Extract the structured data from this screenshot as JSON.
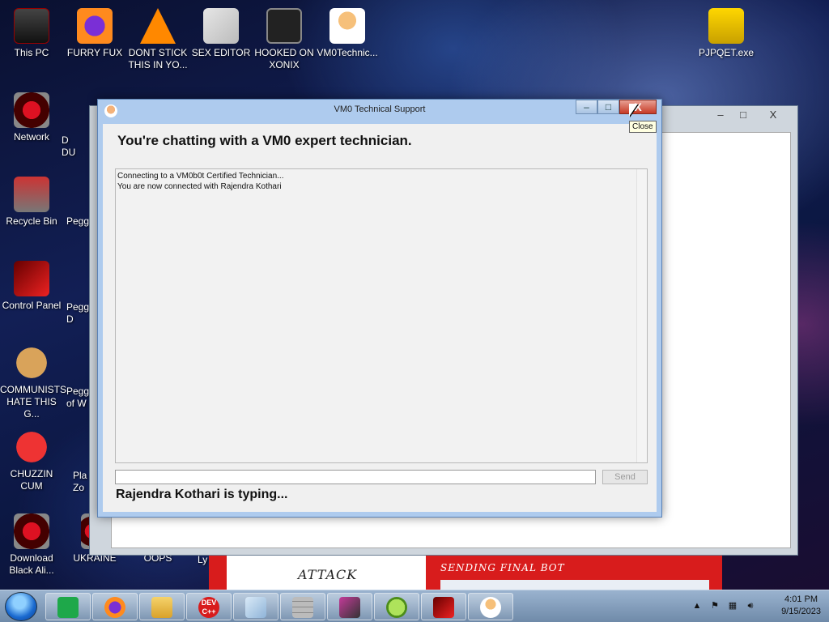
{
  "desktop": {
    "icons": [
      {
        "label": "This PC",
        "icon": "computer-icon"
      },
      {
        "label": "FURRY FUX",
        "icon": "firefox-icon"
      },
      {
        "label": "DONT STICK THIS IN YO...",
        "icon": "vlc-icon"
      },
      {
        "label": "SEX EDITOR",
        "icon": "hxd-icon"
      },
      {
        "label": "HOOKED ON XONIX",
        "icon": "game-icon"
      },
      {
        "label": "VM0Technic...",
        "icon": "doctor-icon"
      },
      {
        "label": "PJPQET.exe",
        "icon": "lock-icon"
      },
      {
        "label": "Network",
        "icon": "network-icon"
      },
      {
        "label": "Recycle Bin",
        "icon": "recycle-bin-icon"
      },
      {
        "label": "Control Panel",
        "icon": "control-panel-icon"
      },
      {
        "label": "COMMUNISTS HATE THIS G...",
        "icon": "money-bag-icon"
      },
      {
        "label": "CHUZZIN CUM",
        "icon": "chuzzle-icon"
      },
      {
        "label": "Download Black Ali...",
        "icon": "download-icon"
      },
      {
        "label": "UKRAINE",
        "icon": "partial-icon"
      },
      {
        "label": "OOPS",
        "icon": "partial-icon"
      }
    ],
    "partial_labels": [
      "D",
      "DU",
      "Pegg",
      "Pegg D",
      "Pegg of W",
      "Pla Zo",
      "Ly"
    ]
  },
  "background_window": {
    "buttons": [
      "–",
      "□",
      "X"
    ]
  },
  "attack_area": {
    "attack_text": "ATTACK",
    "final_text": "SENDING FINAL BOT"
  },
  "dialog": {
    "title": "VM0 Technical Support",
    "heading": "You're chatting with a VM0 expert technician.",
    "chat_lines": [
      "Connecting to a VM0b0t Certified Technician...",
      "You are now connected with Rajendra Kothari"
    ],
    "input_value": "",
    "send_label": "Send",
    "typing_status": "Rajendra Kothari is typing...",
    "caption_buttons": {
      "minimize": "–",
      "maximize": "□",
      "close": "X"
    }
  },
  "tooltip": {
    "text": "Close"
  },
  "taskbar": {
    "pinned": [
      "notes-icon",
      "firefox-icon",
      "file-explorer-icon",
      "dev-cpp-icon",
      "notepad-icon",
      "firewall-icon",
      "display-icon",
      "lime-icon",
      "game-icon",
      "doctor-icon"
    ],
    "dev_label": "DEV C++",
    "clock_time": "4:01 PM",
    "clock_date": "9/15/2023"
  }
}
